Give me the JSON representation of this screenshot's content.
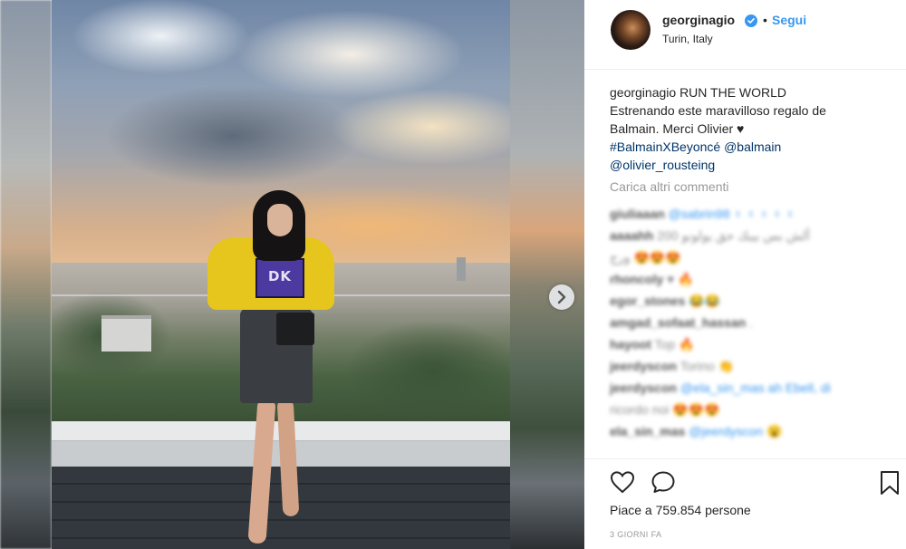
{
  "post": {
    "author": {
      "username": "georginagio",
      "verified": true,
      "follow_label": "Segui",
      "separator": "•",
      "location": "Turin, Italy"
    },
    "caption": {
      "username": "georginagio",
      "text_line1": "RUN THE WORLD",
      "text_line2": "Estrenando este maravilloso regalo de",
      "text_line3": "Balmain. Merci Olivier ♥",
      "hashtag": "#BalmainXBeyoncé",
      "mention1": "@balmain",
      "mention2": "@olivier_rousteing"
    },
    "load_more_label": "Carica altri commenti",
    "comments": [
      {
        "user": "giuliaaan",
        "text": "@sabrin98 ♀ ♀ ♀ ♀ ♀"
      },
      {
        "user": "aaaahh",
        "text": "ألش بس بيبك حق يولونو 200"
      },
      {
        "user": "",
        "text": "ورج 😍😍😍"
      },
      {
        "user": "rhoncoly",
        "text": "♥ 🔥"
      },
      {
        "user": "egor_stones",
        "text": "😂😂"
      },
      {
        "user": "amgad_sofaat_hassan",
        "text": "."
      },
      {
        "user": "hayoot",
        "text": "Top 🔥"
      },
      {
        "user": "jeerdyscon",
        "text": "Torino 👏"
      },
      {
        "user": "jeerdyscon",
        "text": "@ela_sin_mas ah Ebell, di"
      },
      {
        "user": "",
        "text": "ricordo noi 😍😍😍"
      },
      {
        "user": "ela_sin_mas",
        "text": "@jeerdyscon 😮"
      }
    ],
    "likes_text": "Piace a 759.854 persone",
    "time_text": "3 GIORNI FA",
    "photo": {
      "logo_text": "DK"
    },
    "icons": {
      "like": "heart-icon",
      "comment": "comment-icon",
      "save": "bookmark-icon",
      "next": "chevron-right-icon",
      "verified": "verified-badge-icon"
    },
    "colors": {
      "link": "#003569",
      "accent": "#3897f0",
      "text": "#262626",
      "muted": "#999999"
    }
  }
}
